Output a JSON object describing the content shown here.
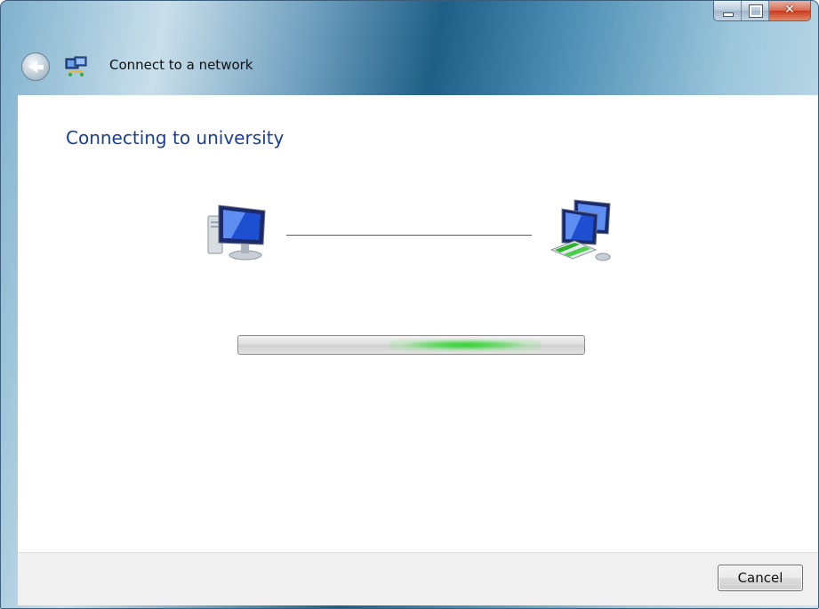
{
  "window": {
    "title": "Connect to a network",
    "caption_buttons": {
      "minimize": "minimize-icon",
      "maximize": "maximize-icon",
      "close": "✕"
    }
  },
  "content": {
    "heading": "Connecting to university",
    "icons": {
      "local": "computer-icon",
      "remote": "network-icon"
    }
  },
  "footer": {
    "cancel_label": "Cancel"
  },
  "colors": {
    "heading": "#1c3f95",
    "progress_glow": "#36d13a"
  }
}
